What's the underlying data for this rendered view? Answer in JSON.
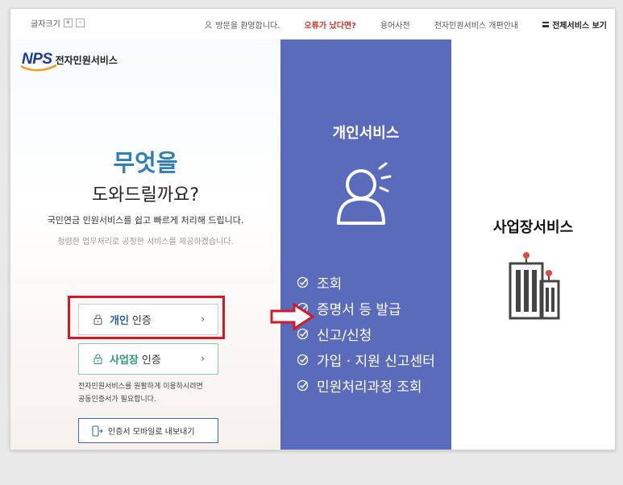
{
  "topbar": {
    "font_size_label": "글자크기",
    "font_plus": "+",
    "font_minus": "-",
    "welcome": "방문을 환영합니다.",
    "error_link": "오류가 났다면?",
    "glossary": "용어사전",
    "reorg_notice": "전자민원서비스 개편안내",
    "all_services": "전체서비스 보기"
  },
  "logo": {
    "brand": "NPS",
    "subtitle": "전자민원서비스"
  },
  "left": {
    "headline1": "무엇을",
    "headline2": "도와드릴까요?",
    "desc1": "국민연금 민원서비스를 쉽고 빠르게 처리해 드립니다.",
    "desc2": "청렴한 업무처리로 공정한 서비스를 제공하겠습니다.",
    "auth_personal_em": "개인",
    "auth_personal_rest": "인증",
    "auth_biz_em": "사업장",
    "auth_biz_rest": "인증",
    "chevron": "›",
    "cert_note_line1": "전자민원서비스를 원활하게 이용하시려면",
    "cert_note_line2": "공동인증서가 필요합니다.",
    "mobile_export": "인증서 모바일로 내보내기"
  },
  "personal_service": {
    "title": "개인서비스",
    "items": [
      "조회",
      "증명서 등 발급",
      "신고/신청",
      "가입 · 지원 신고센터",
      "민원처리과정 조회"
    ]
  },
  "business_service": {
    "title": "사업장서비스"
  },
  "colors": {
    "mid_panel": "#5a6bbb",
    "highlight": "#d4182a",
    "headline": "#2f7fb8",
    "error": "#d2332a"
  }
}
